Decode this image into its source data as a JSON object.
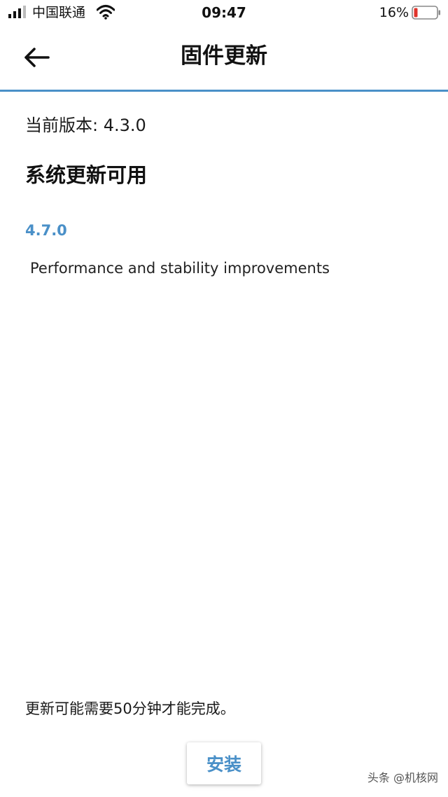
{
  "status_bar": {
    "carrier": "中国联通",
    "time": "09:47",
    "battery_percent": "16%",
    "battery_level": 0.16,
    "battery_color": "#e0342c",
    "icons": [
      "signal-icon",
      "wifi-icon",
      "battery-icon"
    ]
  },
  "header": {
    "title": "固件更新",
    "back_icon": "arrow-left-icon",
    "accent_color": "#4a90c8"
  },
  "content": {
    "current_version": "当前版本: 4.3.0",
    "update_heading": "系统更新可用",
    "new_version": "4.7.0",
    "release_notes": "Performance and stability improvements",
    "duration_note": "更新可能需要50分钟才能完成。"
  },
  "actions": {
    "install_label": "安装"
  },
  "watermark": {
    "text": "头条 @机核网"
  }
}
